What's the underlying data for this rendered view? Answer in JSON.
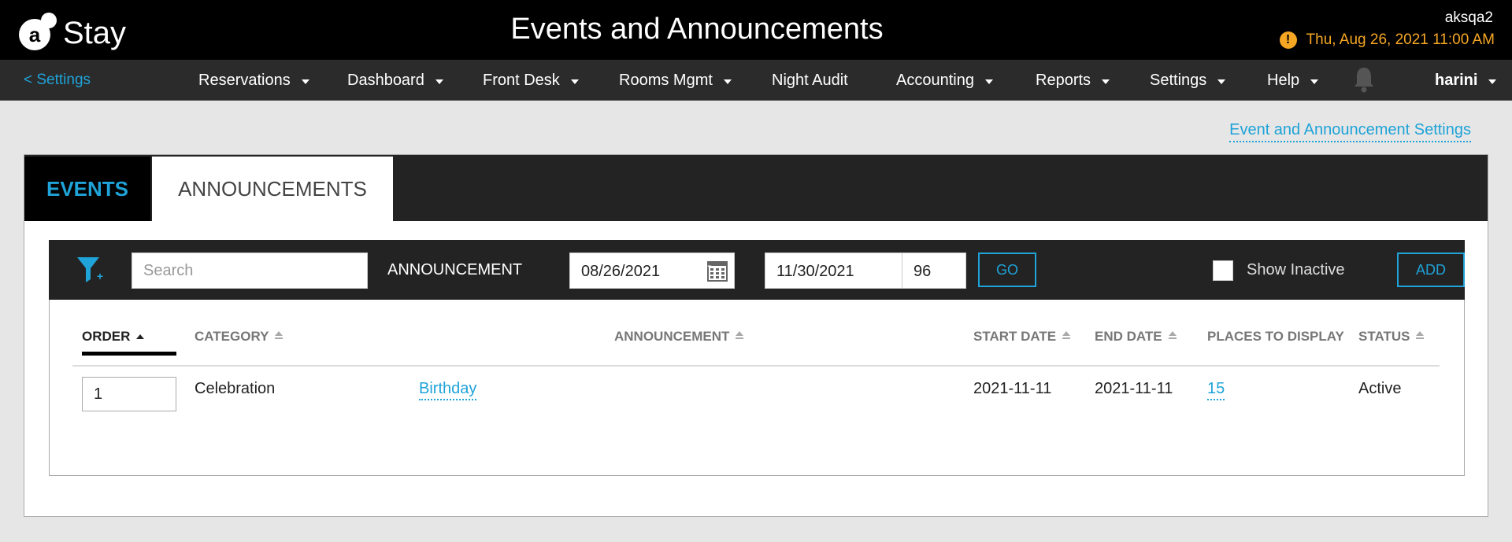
{
  "header": {
    "logo_text": "Stay",
    "title": "Events and Announcements",
    "property": "aksqa2",
    "datetime": "Thu, Aug 26, 2021 11:00 AM",
    "warning_icon": "!"
  },
  "nav": {
    "back_label": "< Settings",
    "items": [
      {
        "label": "Reservations",
        "dropdown": true
      },
      {
        "label": "Dashboard",
        "dropdown": true
      },
      {
        "label": "Front Desk",
        "dropdown": true
      },
      {
        "label": "Rooms Mgmt",
        "dropdown": true
      },
      {
        "label": "Night Audit",
        "dropdown": false
      },
      {
        "label": "Accounting",
        "dropdown": true
      },
      {
        "label": "Reports",
        "dropdown": true
      },
      {
        "label": "Settings",
        "dropdown": true
      },
      {
        "label": "Help",
        "dropdown": true
      }
    ],
    "user": "harini"
  },
  "settings_link": "Event and Announcement Settings",
  "tabs": {
    "events": "EVENTS",
    "announcements": "ANNOUNCEMENTS"
  },
  "filter": {
    "search_placeholder": "Search",
    "type_label": "ANNOUNCEMENT",
    "start_date": "08/26/2021",
    "separator": "-",
    "end_date": "11/30/2021",
    "days": "96",
    "go_label": "GO",
    "show_inactive_label": "Show Inactive",
    "add_label": "ADD"
  },
  "table": {
    "columns": [
      "ORDER",
      "CATEGORY",
      "ANNOUNCEMENT",
      "START DATE",
      "END DATE",
      "PLACES TO DISPLAY",
      "STATUS"
    ],
    "rows": [
      {
        "order": "1",
        "category": "Celebration",
        "announcement": "Birthday",
        "start_date": "2021-11-11",
        "end_date": "2021-11-11",
        "places": "15",
        "status": "Active"
      }
    ]
  },
  "colors": {
    "accent": "#1fa3d8",
    "warning": "#f5a623",
    "header_bg": "#000000",
    "nav_bg": "#2b2b2b"
  }
}
